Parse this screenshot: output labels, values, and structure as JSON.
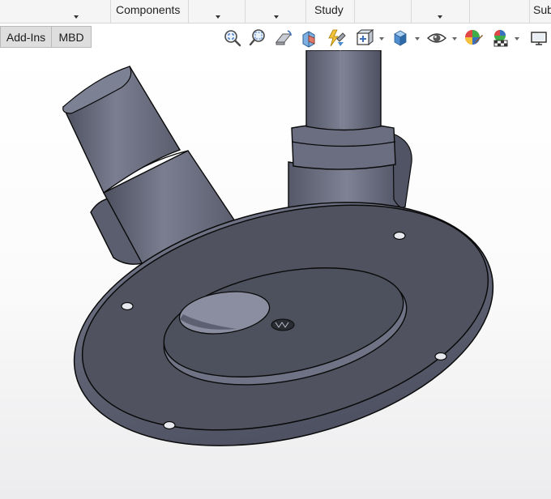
{
  "ribbon": {
    "commands": [
      {
        "label": ""
      },
      {
        "label": "Components"
      },
      {
        "label": ""
      },
      {
        "label": ""
      },
      {
        "label": "Study"
      },
      {
        "label": ""
      },
      {
        "label": ""
      },
      {
        "label": ""
      },
      {
        "label": "Sub"
      }
    ]
  },
  "tabs": [
    {
      "label": "Add-Ins"
    },
    {
      "label": "MBD"
    }
  ],
  "view_toolbar": {
    "icons": [
      "zoom-to-fit-icon",
      "zoom-to-area-icon",
      "previous-view-icon",
      "section-view-icon",
      "dynamic-annotation-views-icon",
      "view-orientation-icon",
      "display-style-icon",
      "hide-show-items-icon",
      "edit-appearance-icon",
      "apply-scene-icon",
      "view-settings-icon"
    ]
  },
  "viewport": {
    "model_name": "flange with two angled tubes",
    "colors": {
      "body": "#5c5f70",
      "face_dark": "#4e5160",
      "face_light": "#8a8ea0",
      "edge": "#0a0a0a",
      "background": "#ffffff"
    }
  }
}
